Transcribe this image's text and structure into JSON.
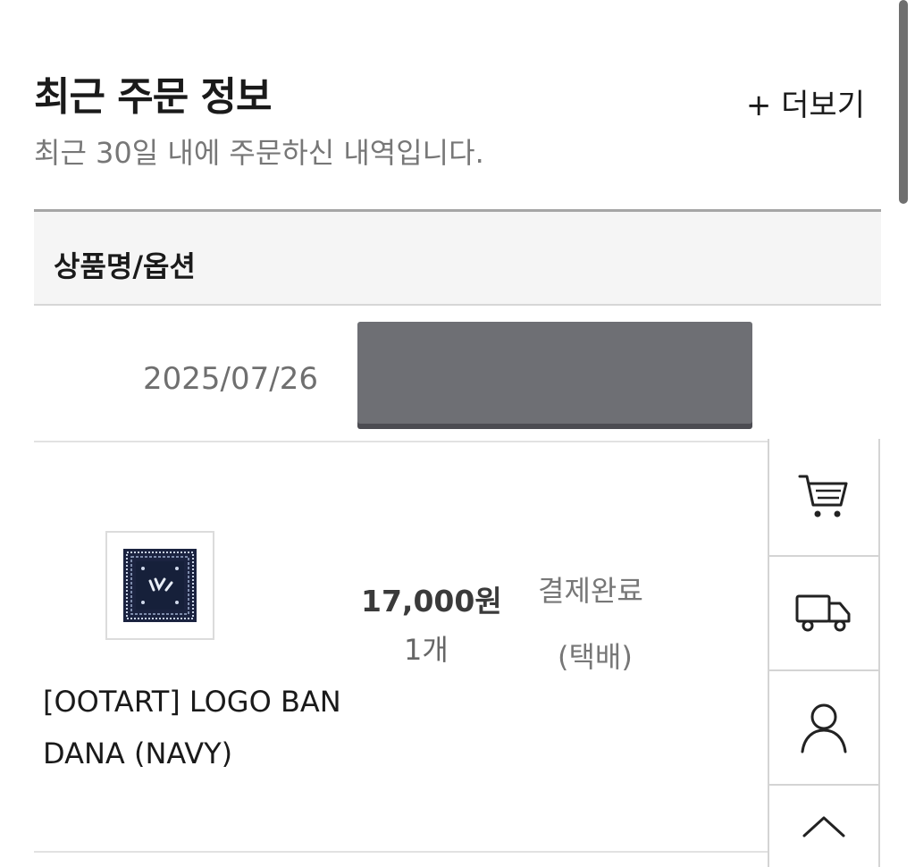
{
  "section": {
    "title": "최근 주문 정보",
    "more_label": "+ 더보기",
    "subtitle": "최근 30일 내에 주문하신 내역입니다."
  },
  "table": {
    "header": "상품명/옵션"
  },
  "order": {
    "date": "2025/07/26",
    "item": {
      "name": "[OOTART] LOGO BANDANA (NAVY)",
      "price": "17,000원",
      "quantity": "1개",
      "status": "결제완료",
      "delivery_type": "(택배)",
      "thumbnail_color": "#1b2340"
    }
  },
  "side_rail": {
    "buttons": [
      {
        "icon": "cart-icon"
      },
      {
        "icon": "truck-icon"
      },
      {
        "icon": "user-icon"
      },
      {
        "icon": "chevron-up-icon"
      }
    ]
  }
}
